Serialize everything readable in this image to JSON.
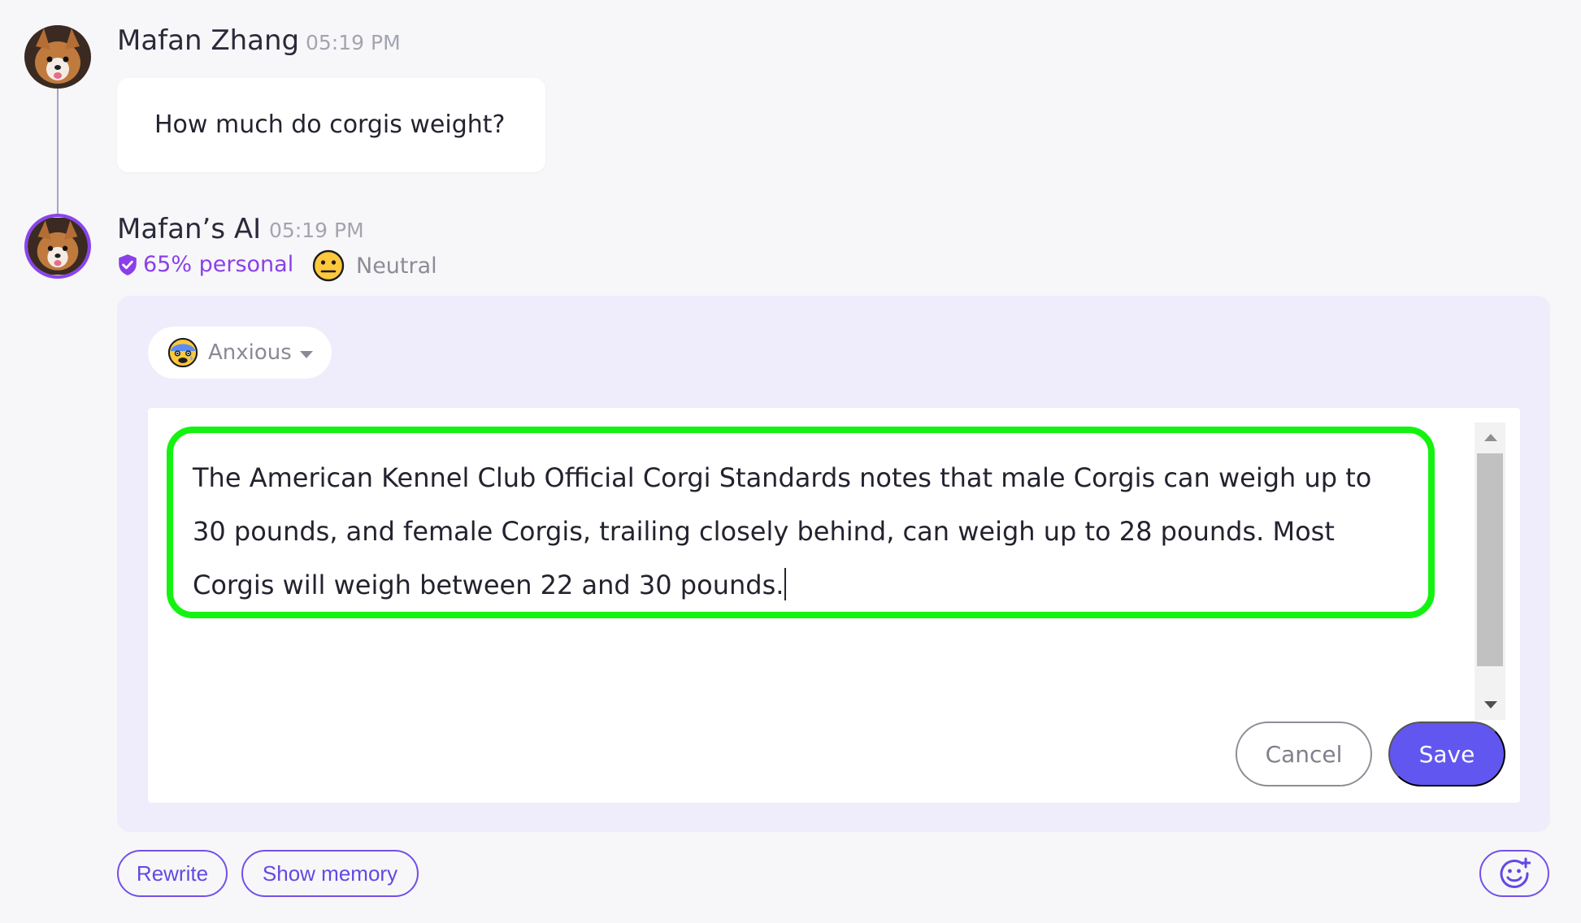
{
  "thread": {
    "user_message": {
      "author": "Mafan Zhang",
      "time": "05:19 PM",
      "text": "How much do corgis weight?",
      "avatar_icon": "corgi-avatar"
    },
    "ai_message": {
      "author": "Mafan’s AI",
      "time": "05:19 PM",
      "personal_label": "65% personal",
      "mood_label": "Neutral",
      "mood_icon": "neutral-face-icon",
      "avatar_icon": "corgi-avatar",
      "accent_color": "#8b43ee"
    }
  },
  "editor": {
    "mood_select": {
      "value": "Anxious",
      "icon": "anxious-face-icon"
    },
    "text": "The American Kennel Club Official Corgi Standards notes that male Corgis can weigh up to 30 pounds, and female Corgis, trailing closely behind, can weigh up to 28 pounds. Most Corgis will weigh between 22 and 30 pounds.",
    "highlight_color": "#14f310",
    "cancel_label": "Cancel",
    "save_label": "Save",
    "save_color": "#6256f0"
  },
  "actions": {
    "rewrite_label": "Rewrite",
    "show_memory_label": "Show memory",
    "add_reaction_icon": "add-emoji-icon"
  }
}
